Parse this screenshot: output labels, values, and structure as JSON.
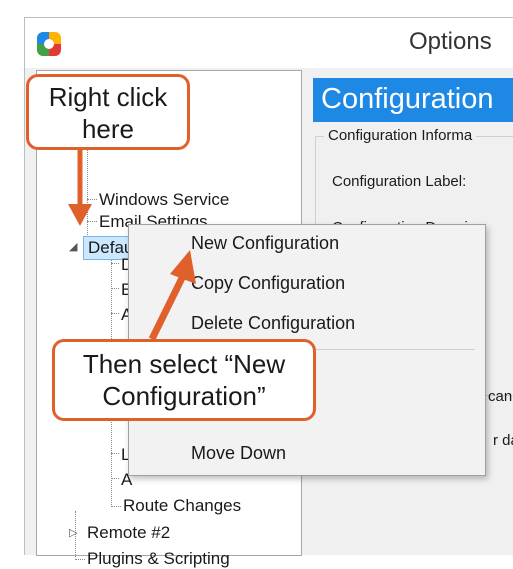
{
  "window": {
    "title": "Options"
  },
  "tree": {
    "items": [
      {
        "label": "Windows Service"
      },
      {
        "label": "Email Settings"
      },
      {
        "label": "Default"
      },
      {
        "label": "D"
      },
      {
        "label": "E"
      },
      {
        "label": "A"
      },
      {
        "label": "L"
      },
      {
        "label": "A"
      },
      {
        "label": "Route Changes"
      },
      {
        "label": "Remote #2"
      },
      {
        "label": "Plugins & Scripting"
      }
    ]
  },
  "panel": {
    "header": "Configuration",
    "group_title": "Configuration Informa",
    "label_field": "Configuration Label:",
    "description_field": "Configuration Descrip",
    "fragment_1": "can",
    "fragment_2": "r da"
  },
  "context_menu": {
    "items": [
      {
        "label": "New Configuration"
      },
      {
        "label": "Copy Configuration"
      },
      {
        "label": "Delete Configuration"
      },
      {
        "label": "Move Down"
      }
    ]
  },
  "callouts": {
    "first": {
      "line1": "Right click",
      "line2": "here"
    },
    "second": {
      "line1": "Then select “New",
      "line2": "Configuration”"
    }
  },
  "colors": {
    "accent": "#1e88e5",
    "callout_border": "#e0602c",
    "arrow": "#e0602c",
    "selection": "#cce8ff"
  }
}
